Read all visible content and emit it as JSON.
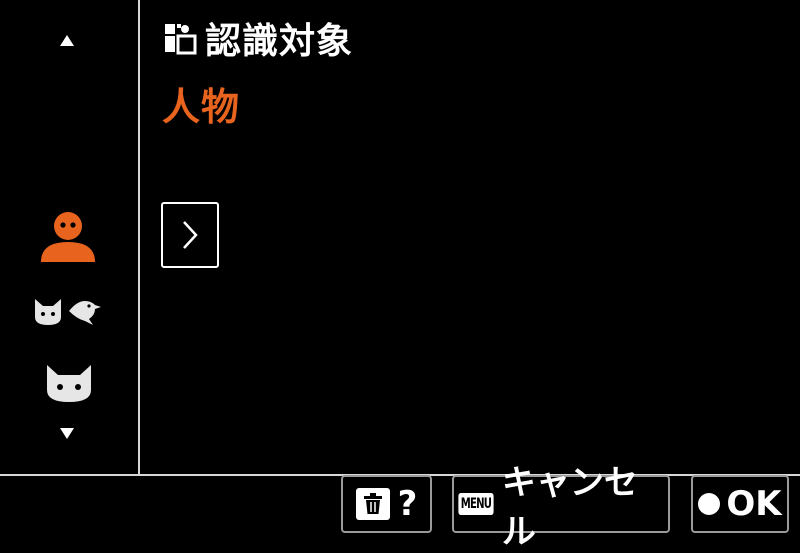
{
  "header": {
    "title": "認識対象",
    "title_icon": "subject-detection-icon"
  },
  "setting": {
    "current_value": "人物",
    "value_color": "#e8641e"
  },
  "sidebar": {
    "items": [
      {
        "icon": "person-icon",
        "selected": true,
        "color": "#e8641e"
      },
      {
        "icon": "animal-bird-icon",
        "selected": false
      },
      {
        "icon": "animal-icon",
        "selected": false
      }
    ],
    "up_icon": "scroll-up-icon",
    "down_icon": "scroll-down-icon"
  },
  "next_button": {
    "icon": "chevron-right-icon"
  },
  "footer": {
    "trash_label": "?",
    "menu_badge": "MENU",
    "menu_label": "キャンセル",
    "ok_label": "OK"
  }
}
